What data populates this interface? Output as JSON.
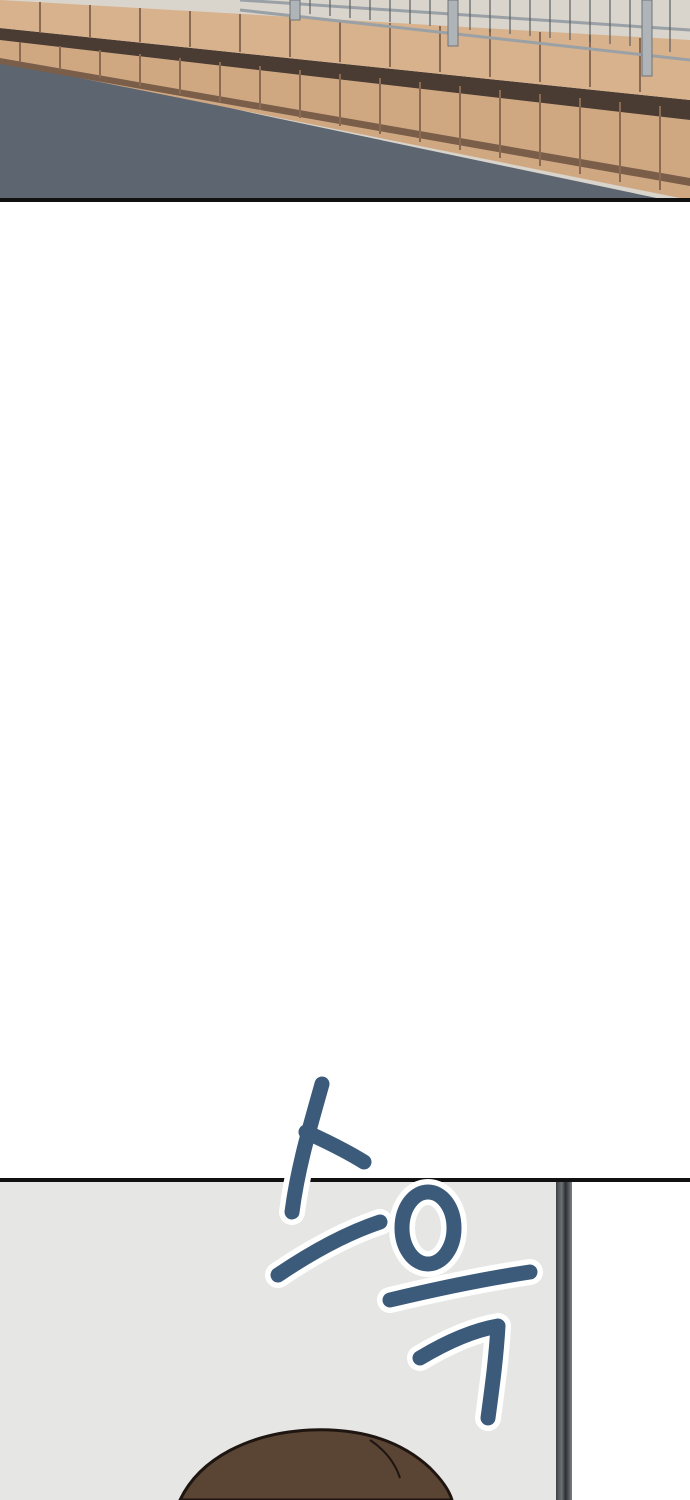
{
  "sound_effect": {
    "text": "스윽",
    "color": "#3c5b7a"
  },
  "colors": {
    "road": "#5d6670",
    "brick": "#cfa882",
    "brick_dark": "#8a6a52",
    "railing": "#9aa1a6",
    "wall": "#e6e6e4",
    "hair": "#5a4434"
  }
}
